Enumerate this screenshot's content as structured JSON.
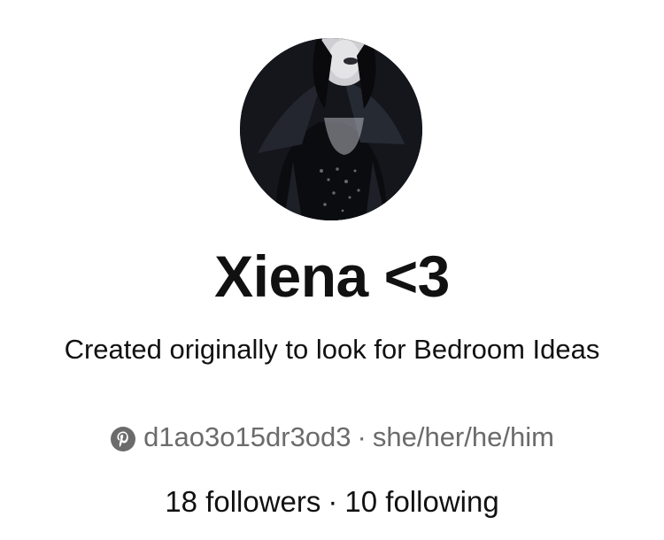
{
  "profile": {
    "display_name": "Xiena <3",
    "bio": "Created originally to look for Bedroom Ideas",
    "username": "d1ao3o15dr3od3",
    "pronouns": "she/her/he/him",
    "separator": "·",
    "followers_label": "18 followers",
    "following_label": "10 following"
  },
  "icons": {
    "platform": "pinterest-icon"
  },
  "colors": {
    "text": "#111111",
    "muted": "#6b6b6b",
    "background": "#ffffff"
  }
}
